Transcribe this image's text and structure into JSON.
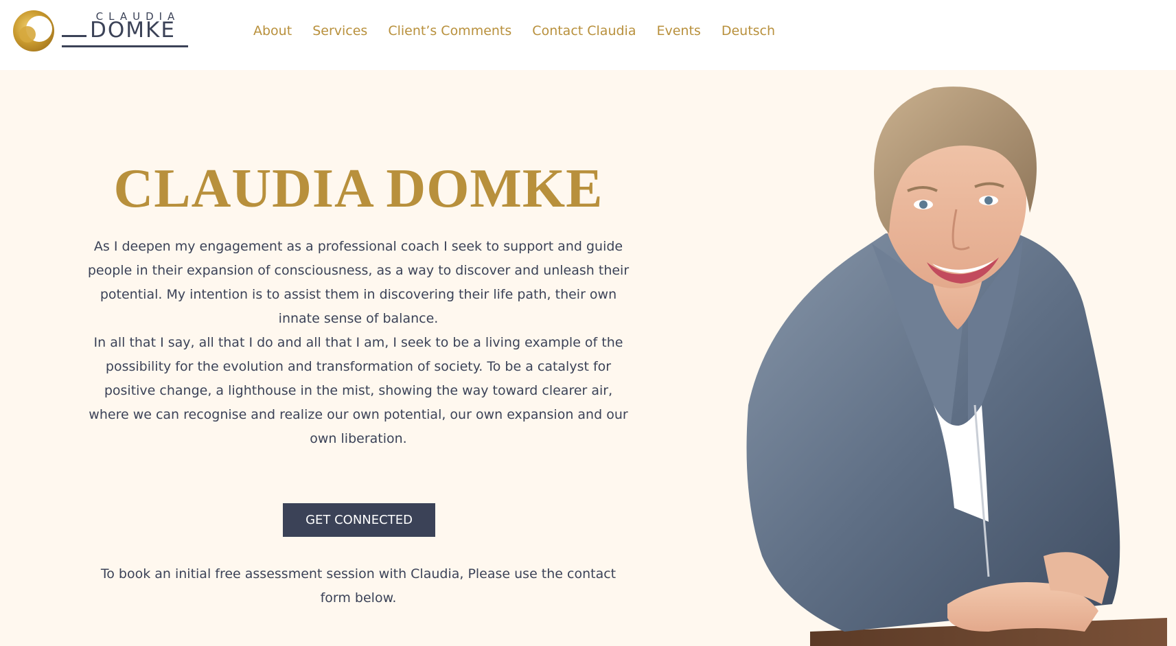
{
  "brand": {
    "logo_top": "CLAUDIA",
    "logo_bottom": "DOMKE",
    "gold": "#b8903c",
    "navy": "#3b4257",
    "hero_bg": "#fff8ef"
  },
  "nav": {
    "items": [
      {
        "label": "About"
      },
      {
        "label": "Services"
      },
      {
        "label": "Client’s Comments"
      },
      {
        "label": "Contact Claudia"
      },
      {
        "label": "Events"
      },
      {
        "label": "Deutsch"
      }
    ]
  },
  "hero": {
    "title": "CLAUDIA DOMKE",
    "paragraph_1": "As I deepen my engagement as a professional coach I seek to support and guide people in their expansion of consciousness, as a way to discover and unleash their potential. My intention is to assist them in discovering their life path, their own innate sense of balance.",
    "paragraph_2": "In all that I say, all that I do and all that I am, I seek to be a living example of the possibility for the evolution and transformation of society. To be a catalyst for positive change, a lighthouse in the mist, showing the way toward clearer air, where we can recognise and realize our own potential, our own expansion and our own liberation.",
    "cta_label": "GET CONNECTED",
    "note": "To book an initial free assessment session with Claudia, Please use the contact form below."
  },
  "portrait": {
    "icon": "portrait-photo"
  }
}
